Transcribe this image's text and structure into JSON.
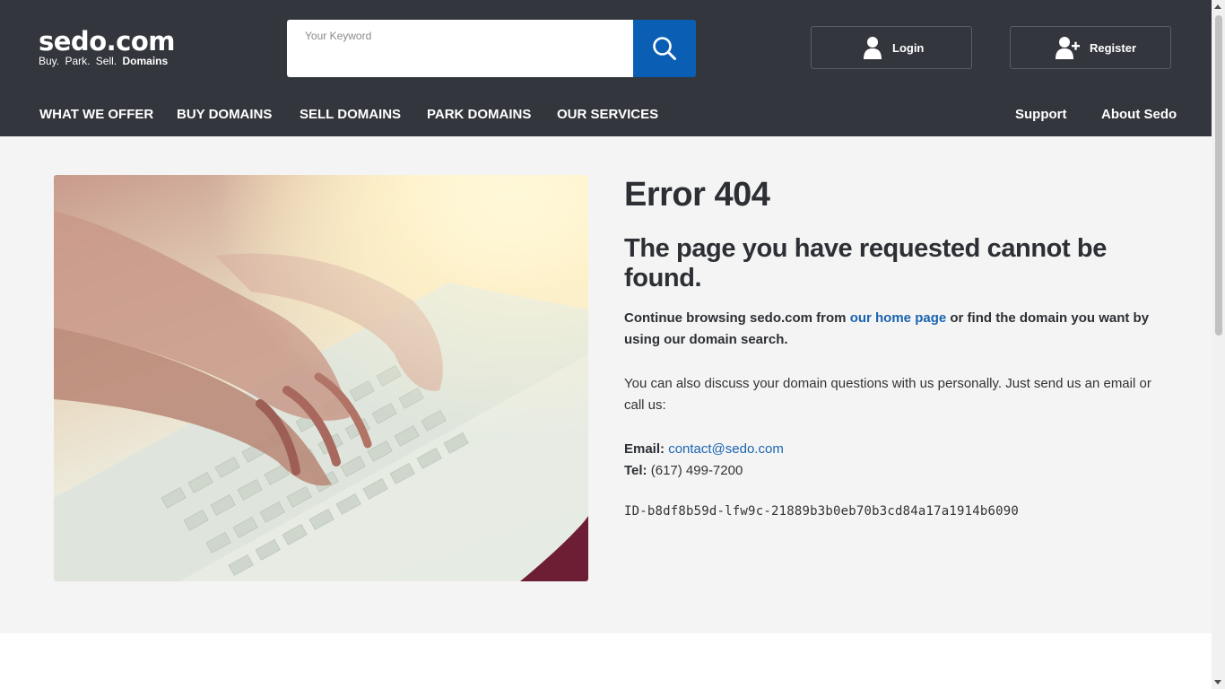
{
  "header": {
    "logo": {
      "main": "sedo.com",
      "tagline_plain": "Buy.  Park.  Sell. ",
      "tagline_bold": "Domains"
    },
    "search": {
      "placeholder": "Your Keyword",
      "value": ""
    },
    "login_label": "Login",
    "register_label": "Register"
  },
  "nav": {
    "items": [
      "WHAT WE OFFER",
      "BUY DOMAINS",
      "SELL DOMAINS",
      "PARK DOMAINS",
      "OUR SERVICES"
    ],
    "right": [
      "Support",
      "About Sedo"
    ]
  },
  "error": {
    "title": "Error 404",
    "subtitle": "The page you have requested cannot be found.",
    "p1_before": "Continue browsing sedo.com from ",
    "p1_link": "our home page",
    "p1_after": " or find the domain you want by using our domain search.",
    "p2": "You can also discuss your domain questions with us personally. Just send us an email or call us:",
    "email_label": "Email:",
    "email": "contact@sedo.com",
    "tel_label": "Tel:",
    "tel": " (617) 499-7200",
    "id": "ID-b8df8b59d-lfw9c-21889b3b0eb70b3cd84a17a1914b6090"
  },
  "colors": {
    "header_bg": "#33363d",
    "accent": "#0a5fb4",
    "link": "#1a64b0",
    "content_bg": "#f4f4f4"
  },
  "icons": {
    "search": "magnifier-icon",
    "login": "user-icon",
    "register": "user-plus-icon"
  }
}
